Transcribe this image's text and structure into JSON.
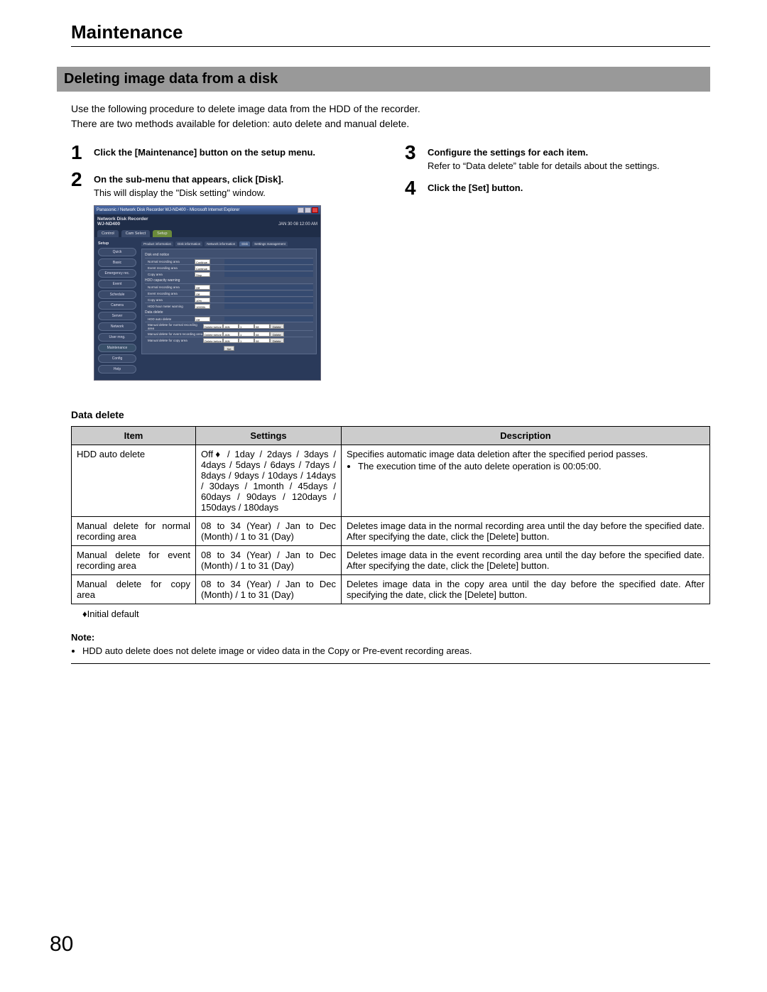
{
  "page": {
    "title": "Maintenance",
    "section_title": "Deleting image data from a disk",
    "intro_line1": "Use the following procedure to delete image data from the HDD of the recorder.",
    "intro_line2": "There are two methods available for deletion: auto delete and manual delete.",
    "page_number": "80"
  },
  "steps": {
    "s1": {
      "num": "1",
      "bold": "Click the [Maintenance] button on the setup menu."
    },
    "s2": {
      "num": "2",
      "bold": "On the sub-menu that appears, click [Disk].",
      "sub": "This will display the \"Disk setting\" window."
    },
    "s3": {
      "num": "3",
      "bold": "Configure the settings for each item.",
      "sub": "Refer to “Data delete” table for details about the settings."
    },
    "s4": {
      "num": "4",
      "bold": "Click the [Set] button."
    }
  },
  "screenshot": {
    "ie_title": "Panasonic / Network Disk Recorder WJ-ND400 - Microsoft Internet Explorer",
    "brand_line1": "Network Disk Recorder",
    "brand_line2": "WJ-ND400",
    "datetime": "JAN 30 08  12:00  AM",
    "tabs": {
      "control": "Control",
      "cam_select": "Cam Select",
      "setup": "Setup"
    },
    "side_title": "Setup",
    "side": [
      "Quick",
      "Basic",
      "Emergency rec.",
      "Event",
      "Schedule",
      "Camera",
      "Server",
      "Network",
      "User mng.",
      "Maintenance",
      "Config",
      "Help"
    ],
    "subtabs": [
      "Product information",
      "Disk information",
      "Network information",
      "Disk",
      "Settings management"
    ],
    "panel": {
      "sec1_title": "Disk end notice",
      "sec1_rows": [
        {
          "label": "Normal recording area",
          "val": "Continue"
        },
        {
          "label": "Event recording area",
          "val": "Continue"
        },
        {
          "label": "Copy area",
          "val": "Stop"
        }
      ],
      "sec2_title": "HDD capacity warning",
      "sec2_rows": [
        {
          "label": "Normal recording area",
          "val": "Off"
        },
        {
          "label": "Event recording area",
          "val": "Off"
        },
        {
          "label": "Copy area",
          "val": "10%"
        },
        {
          "label": "HDD hour meter warning",
          "val": "10000h"
        }
      ],
      "sec3_title": "Data delete",
      "sec3_rows": [
        {
          "label": "HDD auto delete",
          "val": "Off"
        }
      ],
      "manual_rows": [
        {
          "label": "Manual delete for normal recording area",
          "before": "Delete before",
          "yy": "JAN",
          "mm": "1",
          "dd": "08",
          "btn": "Delete"
        },
        {
          "label": "Manual delete for event recording area",
          "before": "Delete before",
          "yy": "JAN",
          "mm": "1",
          "dd": "08",
          "btn": "Delete"
        },
        {
          "label": "Manual delete for copy area",
          "before": "Delete before",
          "yy": "JAN",
          "mm": "1",
          "dd": "08",
          "btn": "Delete"
        }
      ],
      "set_btn": "Set"
    }
  },
  "table": {
    "heading": "Data delete",
    "head_item": "Item",
    "head_settings": "Settings",
    "head_desc": "Description",
    "rows": [
      {
        "item": "HDD auto delete",
        "settings": "Off♦ / 1day / 2days / 3days / 4days / 5days / 6days / 7days / 8days / 9days / 10days / 14days / 30days / 1month / 45days / 60days / 90days / 120days / 150days / 180days",
        "desc": "Specifies automatic image data deletion after the specified period passes.",
        "bullet": "The execution time of the auto delete operation is 00:05:00."
      },
      {
        "item": "Manual delete for normal recording area",
        "settings": "08 to 34 (Year) / Jan to Dec (Month) / 1 to 31 (Day)",
        "desc": "Deletes image data in the normal recording area until the day before the specified date. After specifying the date, click the [Delete] button."
      },
      {
        "item": "Manual delete for event recording area",
        "settings": "08 to 34 (Year) / Jan to Dec (Month) / 1 to 31 (Day)",
        "desc": "Deletes image data in the event recording area until the day before the specified date. After specifying the date, click the [Delete] button."
      },
      {
        "item": "Manual delete for copy area",
        "settings": "08 to 34 (Year) / Jan to Dec (Month) / 1 to 31 (Day)",
        "desc": "Deletes image data in the copy area until the day before the specified date. After specifying the date, click the [Delete] button."
      }
    ],
    "initial_default": "♦Initial default"
  },
  "note": {
    "heading": "Note:",
    "bullet": "HDD auto delete does not delete image or video data in the Copy or Pre-event recording areas."
  }
}
